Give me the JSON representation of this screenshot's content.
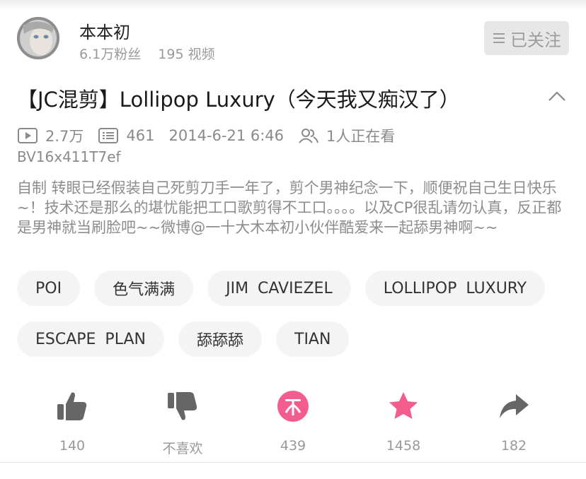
{
  "uploader": {
    "name": "本本初",
    "followers": "6.1万粉丝",
    "videos": "195 视频"
  },
  "follow_button": {
    "icon": "menu-icon",
    "label": "已关注"
  },
  "video": {
    "title": "【JC混剪】Lollipop  Luxury（今天我又痴汉了）",
    "plays": "2.7万",
    "danmaku": "461",
    "date": "2014-6-21 6:46",
    "watching": "1人正在看",
    "bvid": "BV16x411T7ef",
    "description": "自制 转眼已经假装自己死剪刀手一年了，剪个男神纪念一下，顺便祝自己生日快乐~！技术还是那么的堪忧能把工口歌剪得不工口。。。。以及CP很乱请勿认真，反正都是男神就当刷脸吧~~微博@一十大木本初小伙伴酷爱来一起舔男神啊~~"
  },
  "tags": [
    "POI",
    "色气满满",
    "JIM  CAVIEZEL",
    "LOLLIPOP  LUXURY",
    "ESCAPE  PLAN",
    "舔舔舔",
    "TIAN"
  ],
  "actions": {
    "like": "140",
    "dislike": "不喜欢",
    "coin": "439",
    "favorite": "1458",
    "share": "182"
  },
  "colors": {
    "accent_pink": "#f25d8e",
    "icon_gray": "#666666",
    "follow_bg": "#e7e7e7"
  }
}
